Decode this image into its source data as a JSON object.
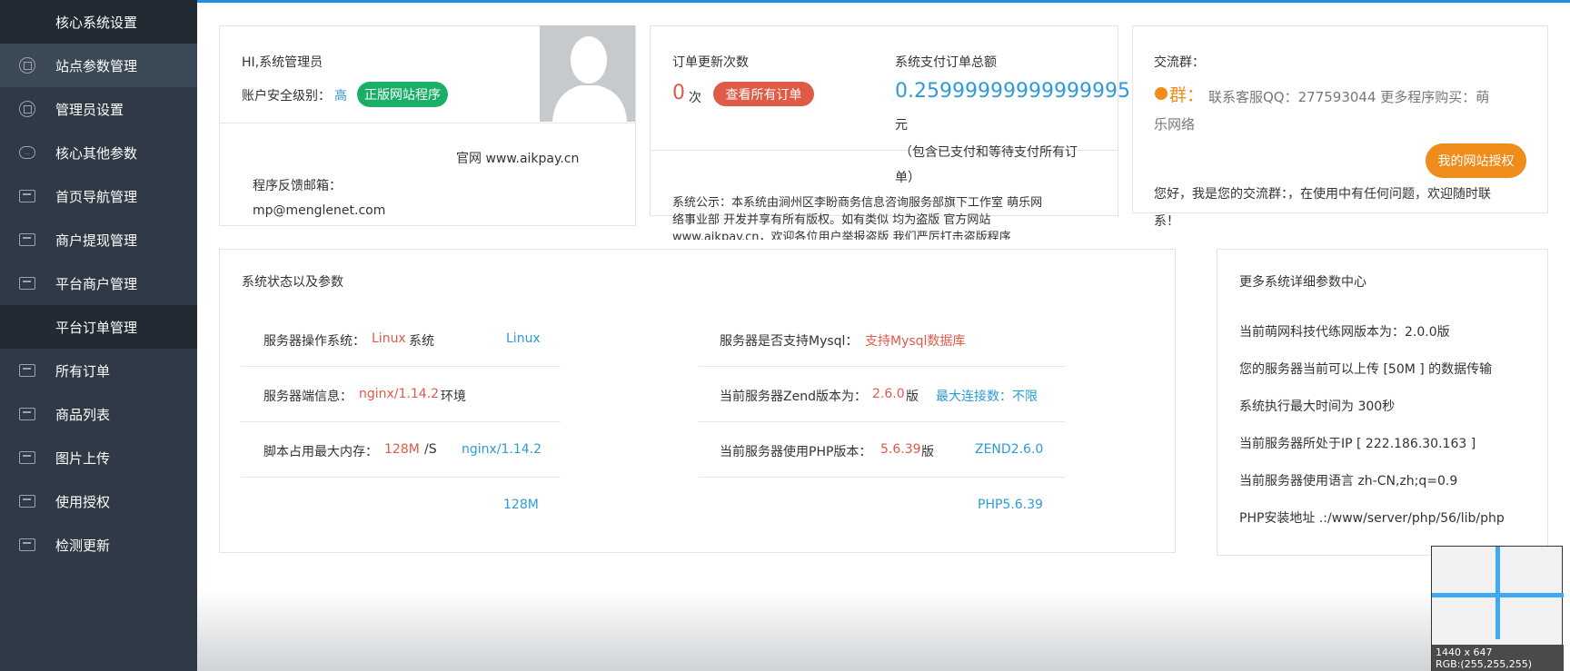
{
  "sidebar": {
    "items": [
      {
        "label": "核心系统设置",
        "icon": "none",
        "kind": "group"
      },
      {
        "label": "站点参数管理",
        "icon": "circle-icon",
        "kind": "active"
      },
      {
        "label": "管理员设置",
        "icon": "circle-icon",
        "kind": "normal"
      },
      {
        "label": "核心其他参数",
        "icon": "chat-icon",
        "kind": "normal"
      },
      {
        "label": "首页导航管理",
        "icon": "box-icon",
        "kind": "normal"
      },
      {
        "label": "商户提现管理",
        "icon": "box-icon",
        "kind": "normal"
      },
      {
        "label": "平台商户管理",
        "icon": "box-icon",
        "kind": "normal"
      },
      {
        "label": "平台订单管理",
        "icon": "none",
        "kind": "group"
      },
      {
        "label": "所有订单",
        "icon": "box-icon",
        "kind": "normal"
      },
      {
        "label": "商品列表",
        "icon": "box-icon",
        "kind": "normal"
      },
      {
        "label": "图片上传",
        "icon": "box-icon",
        "kind": "normal"
      },
      {
        "label": "使用授权",
        "icon": "box-icon",
        "kind": "normal"
      },
      {
        "label": "检测更新",
        "icon": "box-icon",
        "kind": "normal"
      }
    ]
  },
  "user_panel": {
    "greeting": "HI,系统管理员",
    "security_label": "账户安全级别：",
    "security_level": "高",
    "genuine_button": "正版网站程序",
    "website": "官网 www.aikpay.cn",
    "feedback_label": "程序反馈邮箱：",
    "feedback_email": "mp@menglenet.com"
  },
  "orders_panel": {
    "update_count_label": "订单更新次数",
    "update_count": "0",
    "times_unit": "次",
    "view_all_button": "查看所有订单",
    "total_label": "系统支付订单总额",
    "total_value": "0.25999999999999995",
    "total_unit": "元",
    "total_note_1": "（包含已支付和等待支付所有订",
    "total_note_2": "单）",
    "notice_1": "系统公示：本系统由涧州区李盼商务信息咨询服务部旗下工作室 萌乐网",
    "notice_2": "络事业部 开发并享有所有版权。如有类似 均为盗版 官方网站",
    "notice_3": "www.aikpay.cn，欢迎各位用户举报盗版 我们严厉打击盗版程序"
  },
  "group_panel": {
    "title": "交流群：",
    "group_badge": "群：",
    "contact_text_1": "联系客服QQ：277593044 更多程序购买：萌",
    "contact_text_2": "乐网络",
    "auth_button": "我的网站授权",
    "welcome_1": "您好，我是您的交流群：，在使用中有任何问题，欢迎随时联",
    "welcome_2": "系！"
  },
  "status_panel": {
    "title": "系统状态以及参数",
    "os_label": "服务器操作系统：",
    "os_value": "Linux",
    "os_suffix": "系统",
    "os_right": "Linux",
    "server_label": "服务器端信息：",
    "server_value": "nginx/1.14.2",
    "server_suffix": "环境",
    "mem_label": "脚本占用最大内存：",
    "mem_value": "128M",
    "mem_suffix": "/S",
    "mem_right": "nginx/1.14.2",
    "mem_right_2": "128M",
    "mysql_label": "服务器是否支持Mysql：",
    "mysql_value": "支持Mysql数据库",
    "zend_label": "当前服务器Zend版本为：",
    "zend_value": "2.6.0",
    "zend_suffix": "版",
    "zend_right": "最大连接数：不限",
    "php_label": "当前服务器使用PHP版本：",
    "php_value": "5.6.39",
    "php_suffix": "版",
    "php_right": "ZEND2.6.0",
    "php_right_2": "PHP5.6.39"
  },
  "detail_panel": {
    "title": "更多系统详细参数中心",
    "line_1": "当前萌网科技代练网版本为：2.0.0版",
    "line_2": "您的服务器当前可以上传 [50M ] 的数据传输",
    "line_3": "系统执行最大时间为 300秒",
    "line_4": "当前服务器所处于IP [ 222.186.30.163 ]",
    "line_5": "当前服务器使用语言 zh-CN,zh;q=0.9",
    "line_6": "PHP安装地址 .:/www/server/php/56/lib/php"
  },
  "picker": {
    "size": "1440 x 647",
    "rgb": "RGB:(255,255,255)"
  },
  "colors": {
    "sidebar_bg": "#2f3a46",
    "accent_blue": "#2f9bd6",
    "accent_red": "#e05a48",
    "green_button": "#1aaf67",
    "orange_button": "#f08c1c"
  }
}
